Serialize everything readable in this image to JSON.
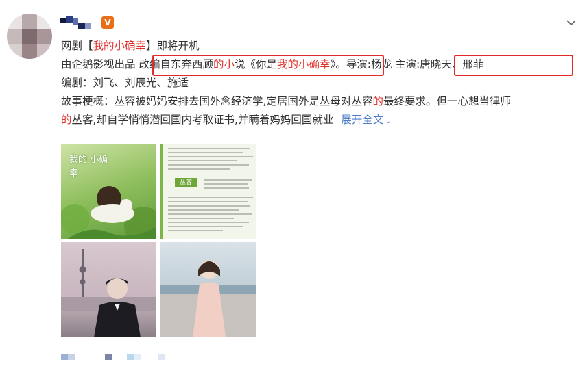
{
  "post": {
    "line1": {
      "prefix": "网剧【",
      "title": "我的小确幸",
      "suffix": "】即将开机"
    },
    "line2": {
      "producer": "由企鹅影视出品",
      "adapt_pre": "改编自东奔西顾",
      "adapt_red": "的小",
      "adapt_mid": "说《你是",
      "adapt_title": "我的小确幸",
      "adapt_end": "》",
      "director": "。导演:杨龙",
      "cast": "主演:唐晓天、邢菲"
    },
    "line3": "编剧：刘飞、刘辰光、施适",
    "line4": {
      "pre": "故事梗概：丛容被妈妈安排去国外念经济学,定居国外是丛母对丛容",
      "red": "的",
      "post": "最终要求。但一心想当律师"
    },
    "line5": {
      "red": "的",
      "text": "丛客,却自学悄悄潜回国内考取证书,并瞒着妈妈回国就业",
      "expand": "展开全文"
    }
  },
  "colors": {
    "text": "#333333",
    "highlight": "#e0332c",
    "link": "#4f7cc8",
    "annotation_box": "#e32a2a",
    "vip_badge": "#e8701a"
  },
  "images": [
    {
      "name": "poster-illustration",
      "cover_text": "我的 小确幸"
    },
    {
      "name": "book-page",
      "cover_text": "丛容"
    },
    {
      "name": "actor-photo"
    },
    {
      "name": "actress-photo"
    }
  ],
  "badge": {
    "label": "V"
  },
  "icons": {
    "more": "chevron-down-icon",
    "verified": "v-badge-icon"
  }
}
